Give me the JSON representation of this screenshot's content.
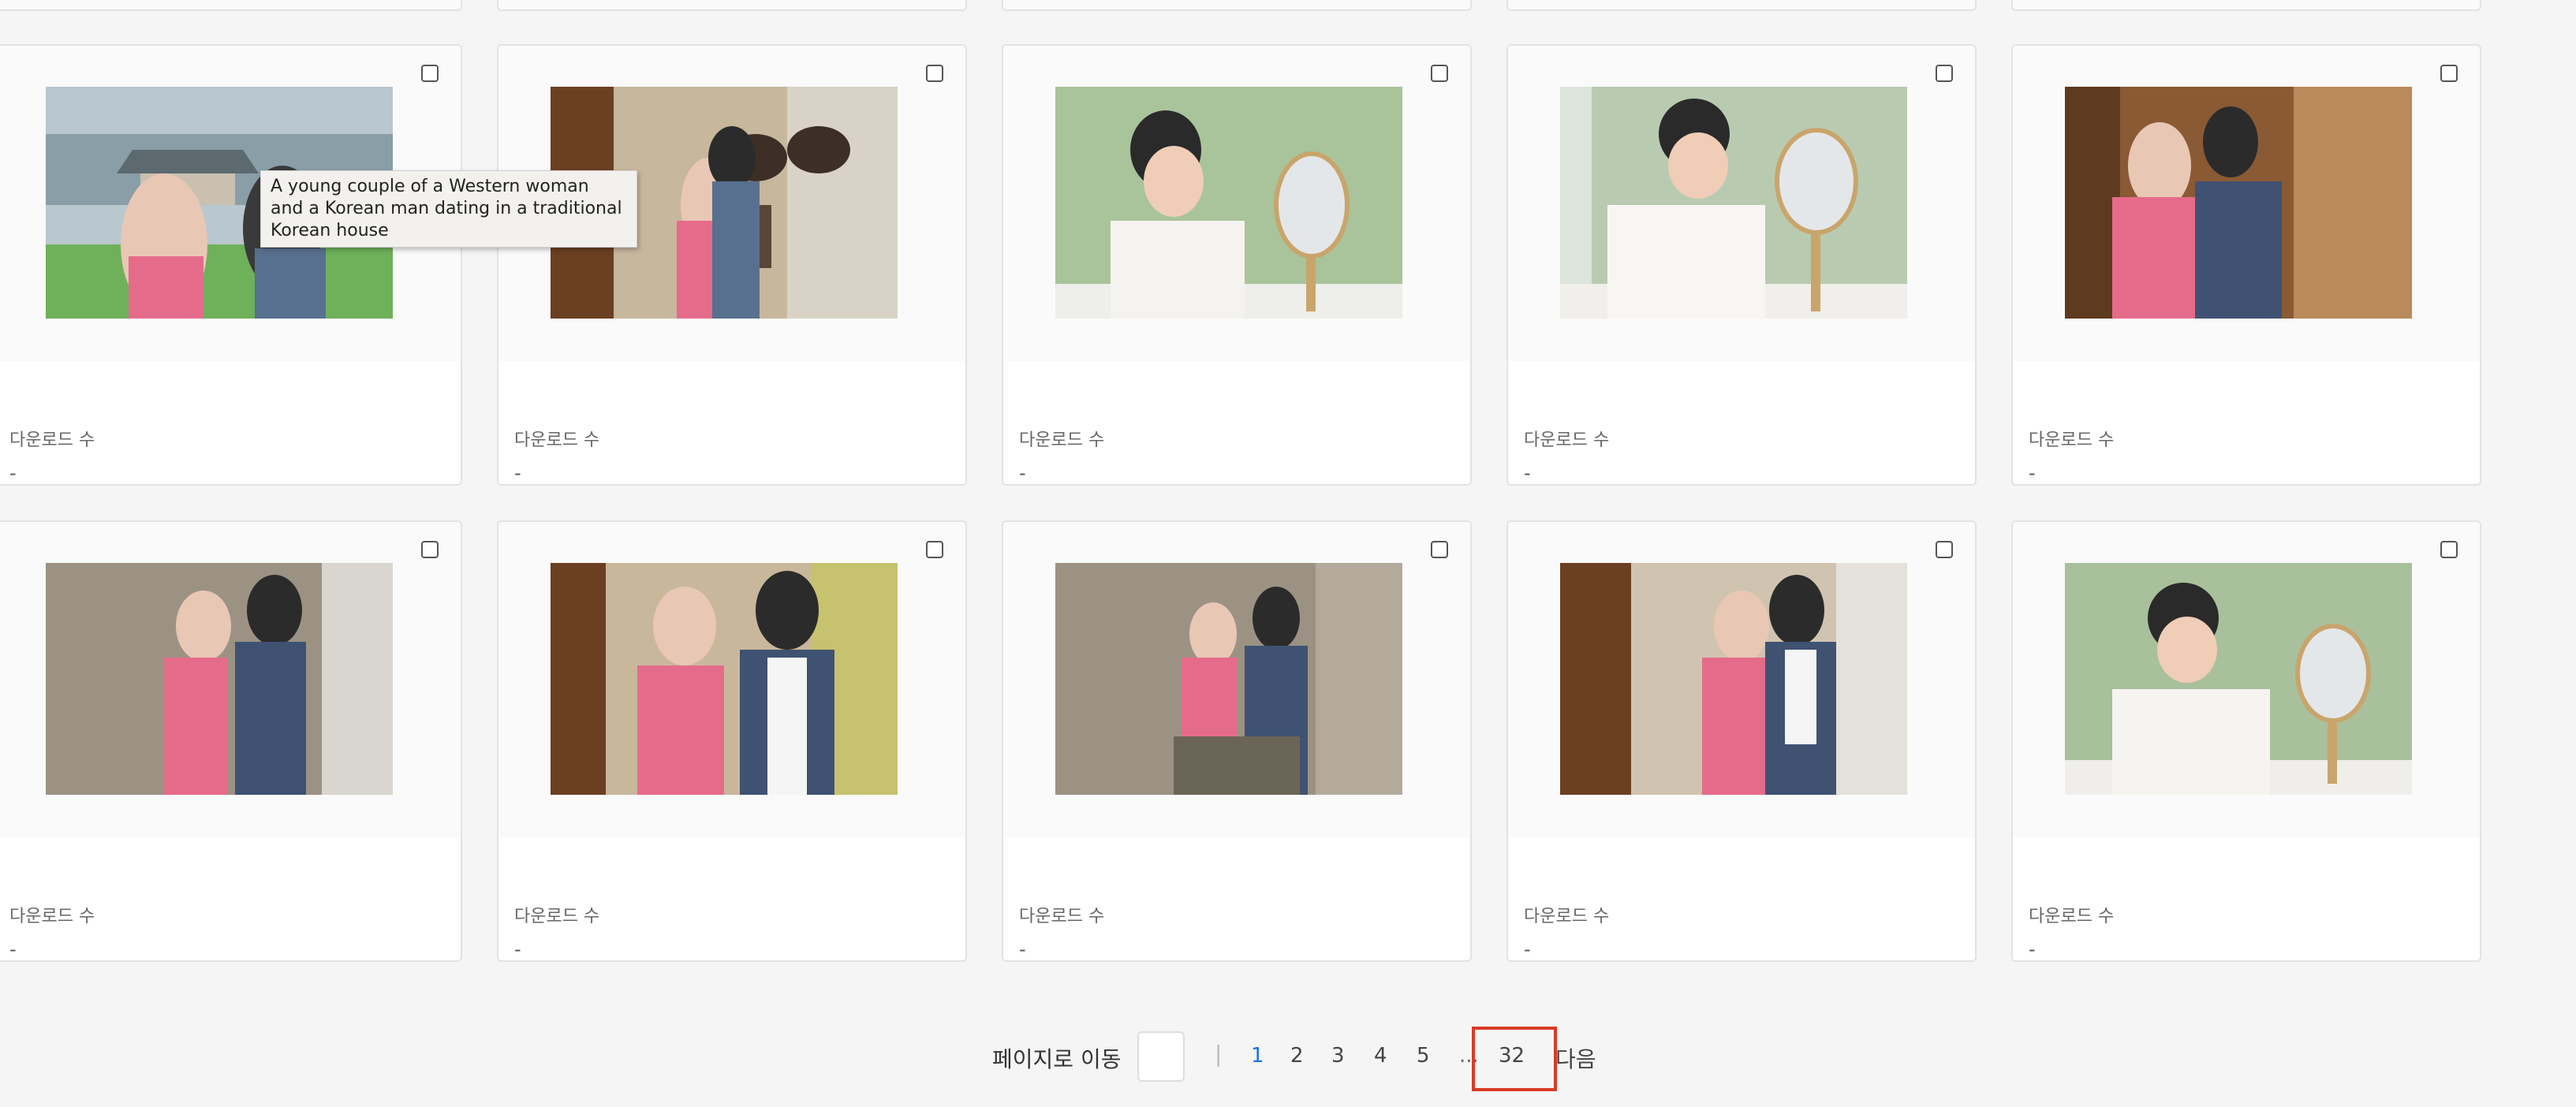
{
  "cards": [
    {
      "download_label": "다운로드 수",
      "download_value": "-",
      "image": "traditional-palace-couple"
    },
    {
      "download_label": "다운로드 수",
      "download_value": "-",
      "image": "hanok-couple-jars"
    },
    {
      "download_label": "다운로드 수",
      "download_value": "-",
      "image": "woman-mirror-bamboo"
    },
    {
      "download_label": "다운로드 수",
      "download_value": "-",
      "image": "woman-mirror-smile"
    },
    {
      "download_label": "다운로드 수",
      "download_value": "-",
      "image": "hanok-couple-window"
    },
    {
      "download_label": "다운로드 수",
      "download_value": "-",
      "image": "couple-stone-wall"
    },
    {
      "download_label": "다운로드 수",
      "download_value": "-",
      "image": "couple-hanok-walk"
    },
    {
      "download_label": "다운로드 수",
      "download_value": "-",
      "image": "couple-wall-point"
    },
    {
      "download_label": "다운로드 수",
      "download_value": "-",
      "image": "couple-hanok-hug"
    },
    {
      "download_label": "다운로드 수",
      "download_value": "-",
      "image": "woman-mirror-rest"
    }
  ],
  "tooltip": "A young couple of a Western woman and a Korean man dating in a traditional Korean house",
  "pagination": {
    "goto_label": "페이지로 이동",
    "separator": "|",
    "pages": [
      "1",
      "2",
      "3",
      "4",
      "5"
    ],
    "ellipsis": "...",
    "last_page": "32",
    "next_label": "다음",
    "active_page": "1"
  },
  "colors": {
    "accent": "#1a73e8",
    "highlight": "#d93a26"
  }
}
